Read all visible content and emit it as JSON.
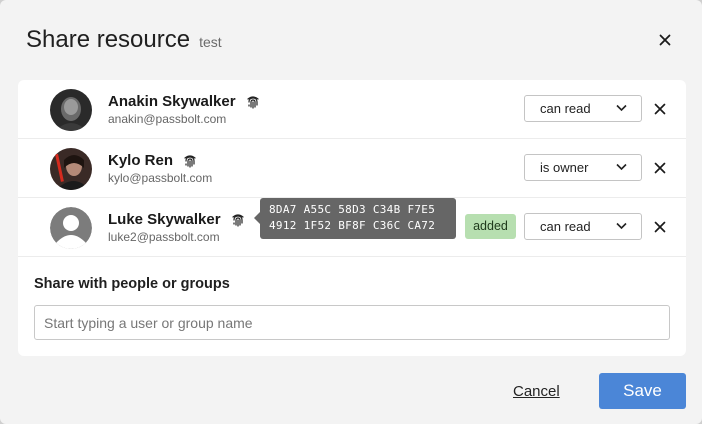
{
  "dialog": {
    "title": "Share resource",
    "subtitle": "test",
    "close_icon": "close-icon"
  },
  "users": [
    {
      "name": "Anakin Skywalker",
      "email": "anakin@passbolt.com",
      "permission": "can read",
      "avatar": "photo-dark"
    },
    {
      "name": "Kylo Ren",
      "email": "kylo@passbolt.com",
      "permission": "is owner",
      "avatar": "photo-red-saber"
    },
    {
      "name": "Luke Skywalker",
      "email": "luke2@passbolt.com",
      "permission": "can read",
      "avatar": "default-user-icon",
      "badge": "added",
      "fingerprint_line1": "8DA7 A55C 58D3 C34B F7E5",
      "fingerprint_line2": "4912 1F52 BF8F C36C CA72"
    }
  ],
  "share": {
    "label": "Share with people or groups",
    "placeholder": "Start typing a user or group name"
  },
  "footer": {
    "cancel_label": "Cancel",
    "save_label": "Save"
  },
  "colors": {
    "save_button": "#4b86d7",
    "badge_added": "#b7dfb0",
    "tooltip": "#666666"
  }
}
